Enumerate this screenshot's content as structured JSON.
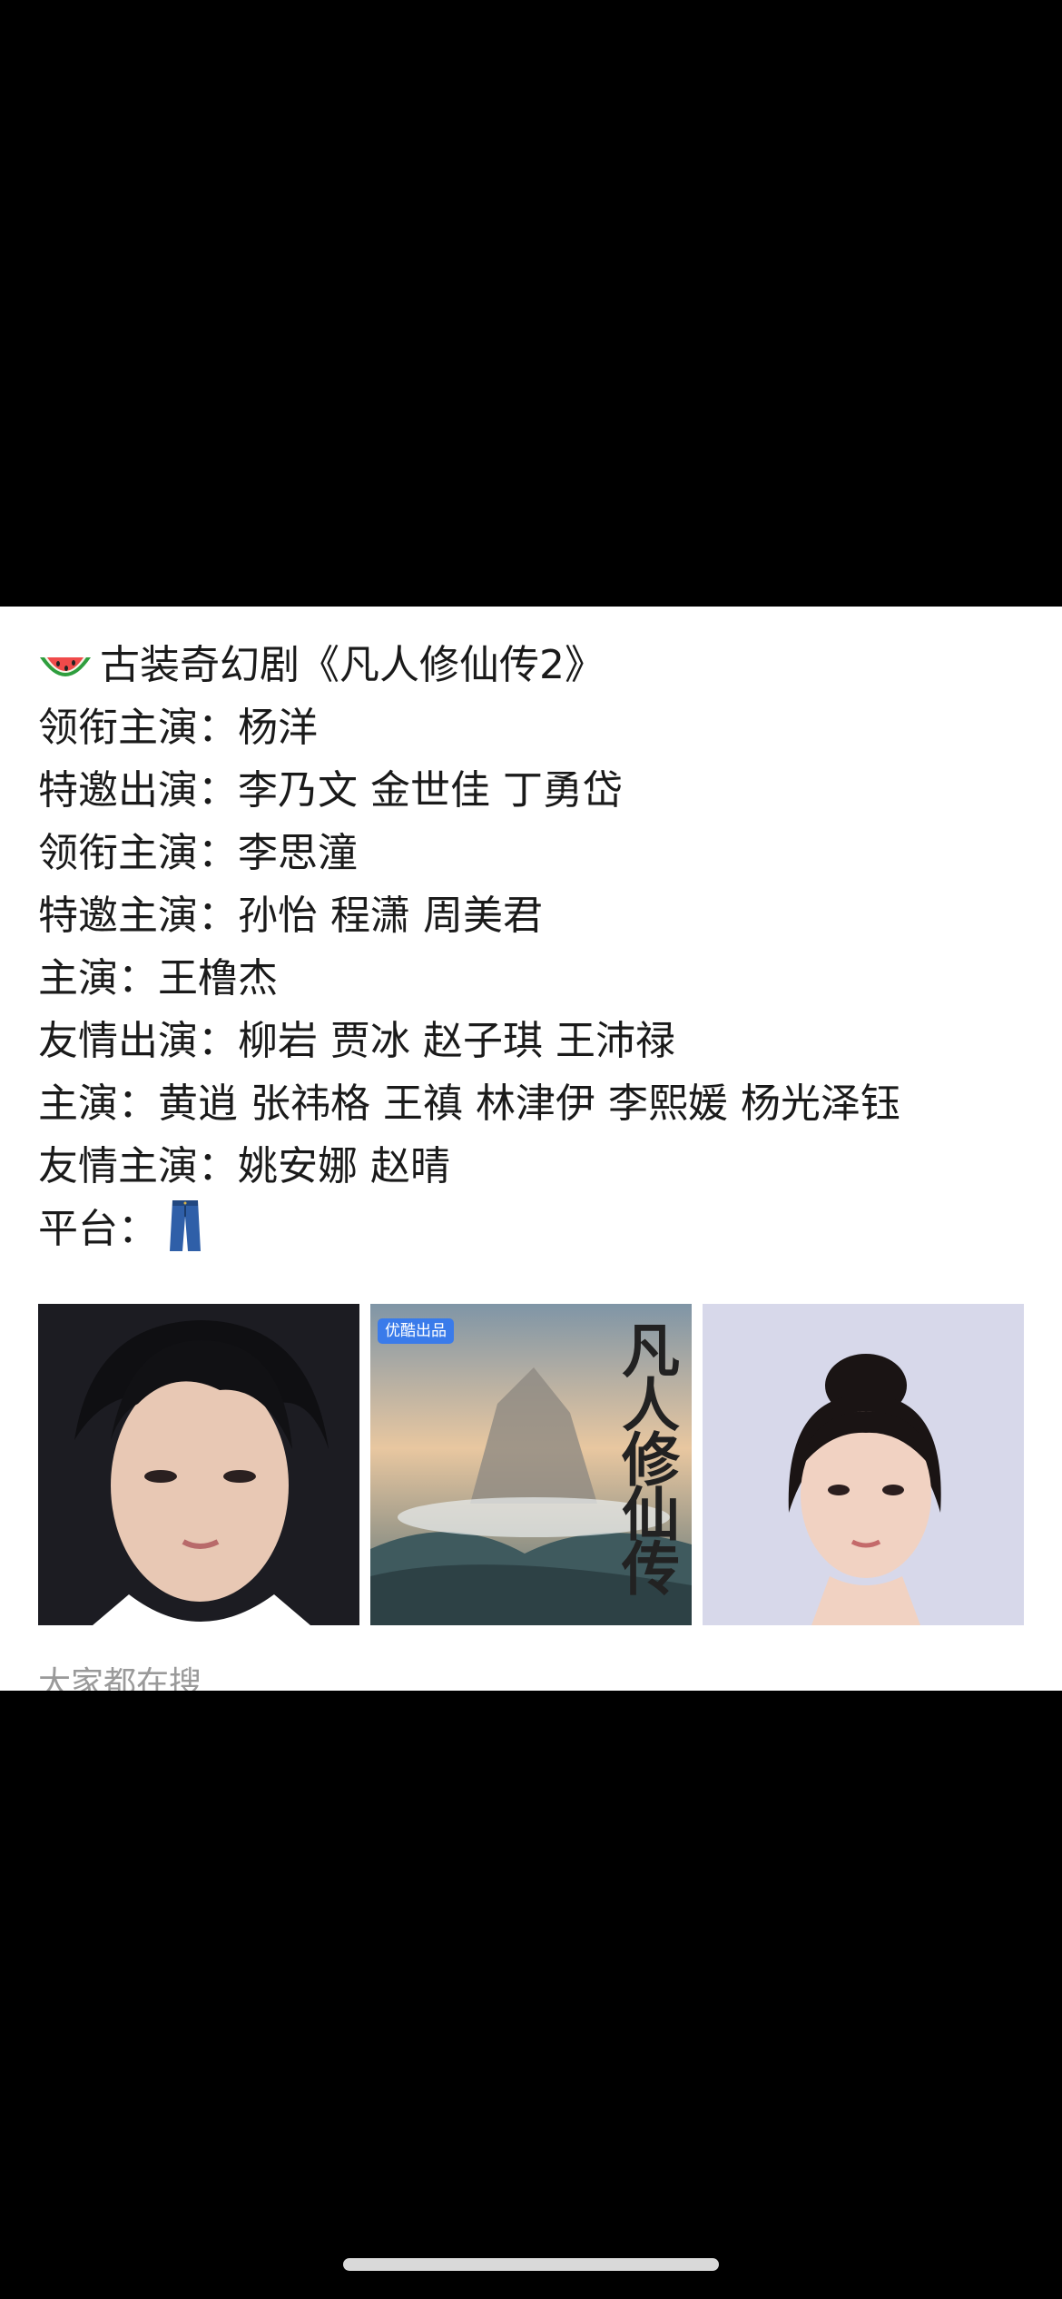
{
  "post": {
    "lines": [
      "古装奇幻剧《凡人修仙传2》",
      "领衔主演：杨洋",
      "特邀出演：李乃文  金世佳  丁勇岱",
      "领衔主演：李思潼",
      "特邀主演：孙怡  程潇  周美君",
      "主演：王橹杰",
      "友情出演：柳岩  贾冰  赵子琪  王沛禄",
      "主演：黄逍  张祎格  王禛  林津伊  李熙媛  杨光泽钰",
      "友情主演：姚安娜  赵晴",
      "平台："
    ],
    "icons": {
      "title_emoji": "watermelon-icon",
      "platform_emoji": "jeans-icon"
    }
  },
  "images": {
    "poster_badge": "优酷出品",
    "poster_title": "凡人修仙传"
  },
  "search_hint": "大家都在搜",
  "colors": {
    "background": "#000000",
    "card": "#ffffff",
    "text": "#1a1a1a",
    "hint": "#9a9a9a",
    "badge": "#3a7bea"
  }
}
